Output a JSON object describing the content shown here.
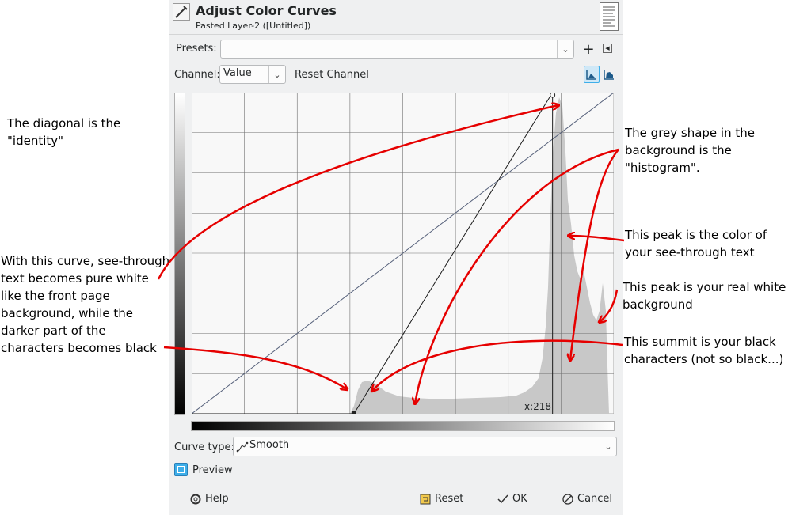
{
  "dialog": {
    "title": "Adjust Color Curves",
    "subtitle": "Pasted Layer-2 ([Untitled])",
    "presets_label": "Presets:",
    "presets_value": "",
    "channel_label": "Channel:",
    "channel_value": "Value",
    "reset_channel": "Reset Channel",
    "cursor_readout": "x:218",
    "curve_type_label": "Curve type:",
    "curve_type_value": "Smooth",
    "preview_label": "Preview",
    "preview_checked": true,
    "help_label": "Help",
    "reset_label": "Reset",
    "ok_label": "OK",
    "cancel_label": "Cancel",
    "curve": {
      "input_range": [
        0,
        255
      ],
      "points": [
        [
          98,
          0
        ],
        [
          218,
          255
        ]
      ]
    },
    "colors": {
      "accent": "#3daee9",
      "arrow": "#e60000",
      "histogram": "#c8c8c8"
    }
  },
  "annotations": {
    "identity": [
      "The diagonal is the",
      "\"identity\""
    ],
    "curve": [
      "With this curve, see-through",
      "text becomes pure white",
      "like the front page",
      "background, while the",
      "darker part of the",
      "characters becomes black"
    ],
    "histogram": [
      "The grey shape in the",
      "background is the",
      "\"histogram\"."
    ],
    "peak_text": [
      "This peak is the color of",
      "your see-through text"
    ],
    "peak_white": [
      "This peak is your real white",
      "background"
    ],
    "summit_black": [
      "This summit is your black",
      "characters (not so black...)"
    ]
  }
}
